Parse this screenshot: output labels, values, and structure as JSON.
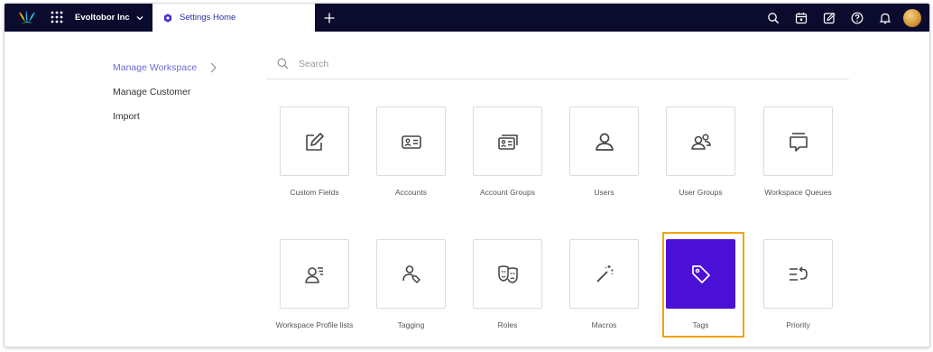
{
  "topbar": {
    "org_name": "Evoltobor Inc",
    "tab_label": "Settings Home",
    "icons": [
      "brand-logo",
      "apps-grid-icon",
      "chevron-down-icon",
      "gear-icon",
      "plus-icon",
      "search-icon",
      "calendar-icon",
      "compose-icon",
      "help-icon",
      "bell-icon",
      "avatar"
    ],
    "bg_color": "#0b0b2e",
    "accent_color": "#2b2ba0"
  },
  "leftnav": {
    "items": [
      {
        "label": "Manage Workspace",
        "active": true
      },
      {
        "label": "Manage Customer",
        "active": false
      },
      {
        "label": "Import",
        "active": false
      }
    ]
  },
  "search": {
    "placeholder": "Search",
    "value": ""
  },
  "tiles": [
    {
      "label": "Custom Fields",
      "icon": "edit-field-icon"
    },
    {
      "label": "Accounts",
      "icon": "id-card-icon"
    },
    {
      "label": "Account Groups",
      "icon": "id-cards-stack-icon"
    },
    {
      "label": "Users",
      "icon": "user-icon"
    },
    {
      "label": "User Groups",
      "icon": "user-group-icon"
    },
    {
      "label": "Workspace Queues",
      "icon": "queue-icon"
    },
    {
      "label": "Workspace Profile lists",
      "icon": "profile-list-icon"
    },
    {
      "label": "Tagging",
      "icon": "user-tag-icon"
    },
    {
      "label": "Roles",
      "icon": "theater-masks-icon"
    },
    {
      "label": "Macros",
      "icon": "magic-wand-icon"
    },
    {
      "label": "Tags",
      "icon": "tag-icon",
      "selected": true
    },
    {
      "label": "Priority",
      "icon": "priority-icon"
    }
  ],
  "selected_color": "#4b10d6",
  "highlight_color": "#f2a20d"
}
